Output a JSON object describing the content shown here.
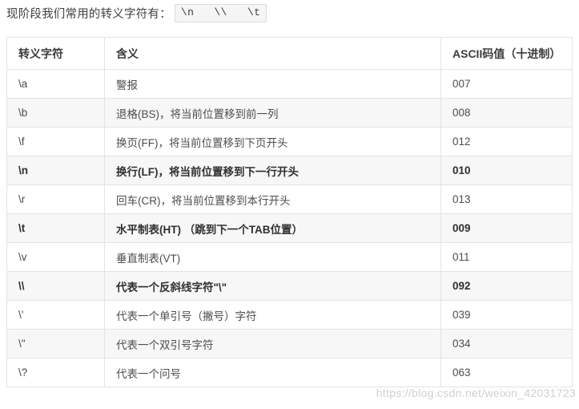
{
  "intro": {
    "text": "现阶段我们常用的转义字符有：",
    "code_badge": "\\n   \\\\   \\t"
  },
  "table": {
    "columns": [
      "转义字符",
      "含义",
      "ASCII码值（十进制）"
    ],
    "rows": [
      {
        "char": "\\a",
        "meaning": "警报",
        "ascii": "007",
        "bold": false
      },
      {
        "char": "\\b",
        "meaning": "退格(BS)，将当前位置移到前一列",
        "ascii": "008",
        "bold": false
      },
      {
        "char": "\\f",
        "meaning": "换页(FF)，将当前位置移到下页开头",
        "ascii": "012",
        "bold": false
      },
      {
        "char": "\\n",
        "meaning": "换行(LF)，将当前位置移到下一行开头",
        "ascii": "010",
        "bold": true
      },
      {
        "char": "\\r",
        "meaning": "回车(CR)，将当前位置移到本行开头",
        "ascii": "013",
        "bold": false
      },
      {
        "char": "\\t",
        "meaning": "水平制表(HT) （跳到下一个TAB位置）",
        "ascii": "009",
        "bold": true
      },
      {
        "char": "\\v",
        "meaning": "垂直制表(VT)",
        "ascii": "011",
        "bold": false
      },
      {
        "char": "\\\\",
        "meaning": "代表一个反斜线字符\"\\\"",
        "ascii": "092",
        "bold": true
      },
      {
        "char": "\\'",
        "meaning": "代表一个单引号（撇号）字符",
        "ascii": "039",
        "bold": false
      },
      {
        "char": "\\\"",
        "meaning": "代表一个双引号字符",
        "ascii": "034",
        "bold": false
      },
      {
        "char": "\\?",
        "meaning": "代表一个问号",
        "ascii": "063",
        "bold": false
      }
    ]
  },
  "watermark": {
    "text": "https://blog.csdn.net/weixin_42031723"
  }
}
